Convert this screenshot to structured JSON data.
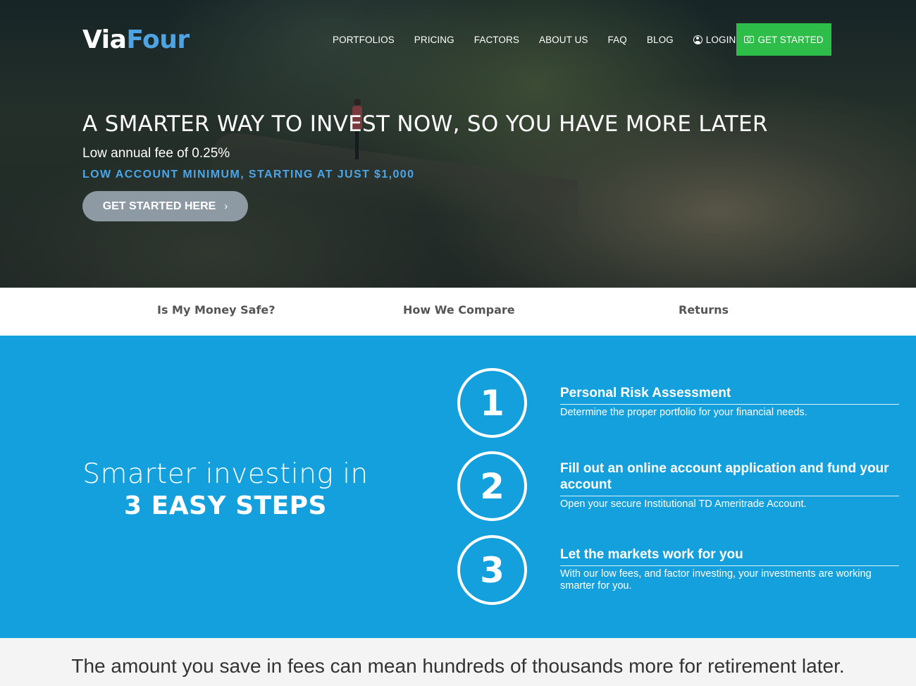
{
  "header": {
    "logo_part1": "Via",
    "logo_part2": "Four",
    "nav": [
      "PORTFOLIOS",
      "PRICING",
      "FACTORS",
      "ABOUT US",
      "FAQ",
      "BLOG"
    ],
    "login_label": "LOGIN",
    "cta_label": "GET STARTED"
  },
  "hero": {
    "title": "A SMARTER WAY TO INVEST NOW, SO YOU HAVE MORE LATER",
    "fee": "Low annual fee of 0.25%",
    "minimum": "LOW ACCOUNT MINIMUM, STARTING AT JUST $1,000",
    "button_label": "GET STARTED HERE",
    "button_chevron": "›"
  },
  "tabs": [
    "Is My Money Safe?",
    "How We Compare",
    "Returns"
  ],
  "steps_section": {
    "intro_line1": "Smarter investing in",
    "intro_line2": "3 EASY STEPS",
    "steps": [
      {
        "number": "1",
        "title": "Personal Risk Assessment",
        "desc": "Determine the proper portfolio for your financial needs."
      },
      {
        "number": "2",
        "title": "Fill out an online account application and fund your account",
        "desc": "Open your secure Institutional TD Ameritrade Account."
      },
      {
        "number": "3",
        "title": "Let the markets work for you",
        "desc": "With our low fees, and factor investing, your investments are working smarter for you."
      }
    ]
  },
  "bottom": {
    "headline": "The amount you save in fees can mean hundreds of thousands more for retirement later."
  },
  "colors": {
    "brand_blue": "#4fa3e0",
    "steps_bg": "#14a0dc",
    "cta_green": "#2ebd48",
    "hero_button": "#8d9aa3"
  }
}
